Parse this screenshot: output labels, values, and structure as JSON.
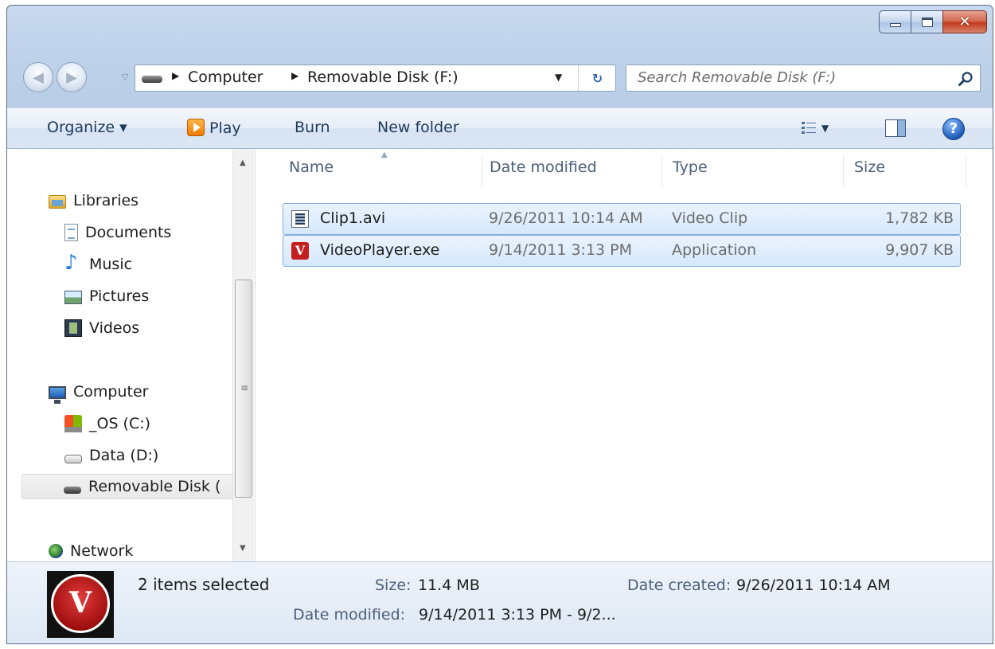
{
  "window": {
    "minimize_icon": "minimize-icon",
    "maximize_icon": "maximize-icon",
    "close_glyph": "✕"
  },
  "nav": {
    "back_glyph": "◀",
    "forward_glyph": "▶",
    "recent_glyph": "▽",
    "address": {
      "crumbs": [
        "Computer",
        "Removable Disk (F:)"
      ],
      "dropdown_glyph": "▼",
      "refresh_glyph": "↻"
    },
    "search": {
      "placeholder": "Search Removable Disk (F:)"
    }
  },
  "toolbar": {
    "organize": "Organize ▾",
    "play": "Play",
    "burn": "Burn",
    "new_folder": "New folder",
    "views_drop": "▼",
    "help_glyph": "?"
  },
  "navpane": {
    "items": [
      {
        "label": "Libraries",
        "icon": "library-icon"
      },
      {
        "label": "Documents",
        "icon": "documents-icon"
      },
      {
        "label": "Music",
        "icon": "music-icon"
      },
      {
        "label": "Pictures",
        "icon": "pictures-icon"
      },
      {
        "label": "Videos",
        "icon": "videos-icon"
      },
      {
        "label": "Computer",
        "icon": "computer-icon"
      },
      {
        "label": "_OS (C:)",
        "icon": "os-drive-icon"
      },
      {
        "label": "Data (D:)",
        "icon": "hard-drive-icon"
      },
      {
        "label": "Removable Disk (",
        "icon": "usb-drive-icon"
      },
      {
        "label": "Network",
        "icon": "network-icon"
      }
    ],
    "scroll_up": "▲",
    "scroll_down": "▼",
    "scroll_grip": "≡"
  },
  "filelist": {
    "columns": [
      "Name",
      "Date modified",
      "Type",
      "Size"
    ],
    "sort_glyph": "▲",
    "rows": [
      {
        "name": "Clip1.avi",
        "date": "9/26/2011 10:14 AM",
        "type": "Video Clip",
        "size": "1,782 KB",
        "icon": "video-file-icon"
      },
      {
        "name": "VideoPlayer.exe",
        "date": "9/14/2011 3:13 PM",
        "type": "Application",
        "size": "9,907 KB",
        "icon": "application-icon",
        "icon_glyph": "V"
      }
    ]
  },
  "details": {
    "selected": "2 items selected",
    "size_label": "Size:",
    "size_value": "11.4 MB",
    "created_label": "Date created:",
    "created_value": "9/26/2011 10:14 AM",
    "modified_label": "Date modified:",
    "modified_value": "9/14/2011 3:13 PM - 9/2...",
    "thumb_glyph": "V"
  }
}
